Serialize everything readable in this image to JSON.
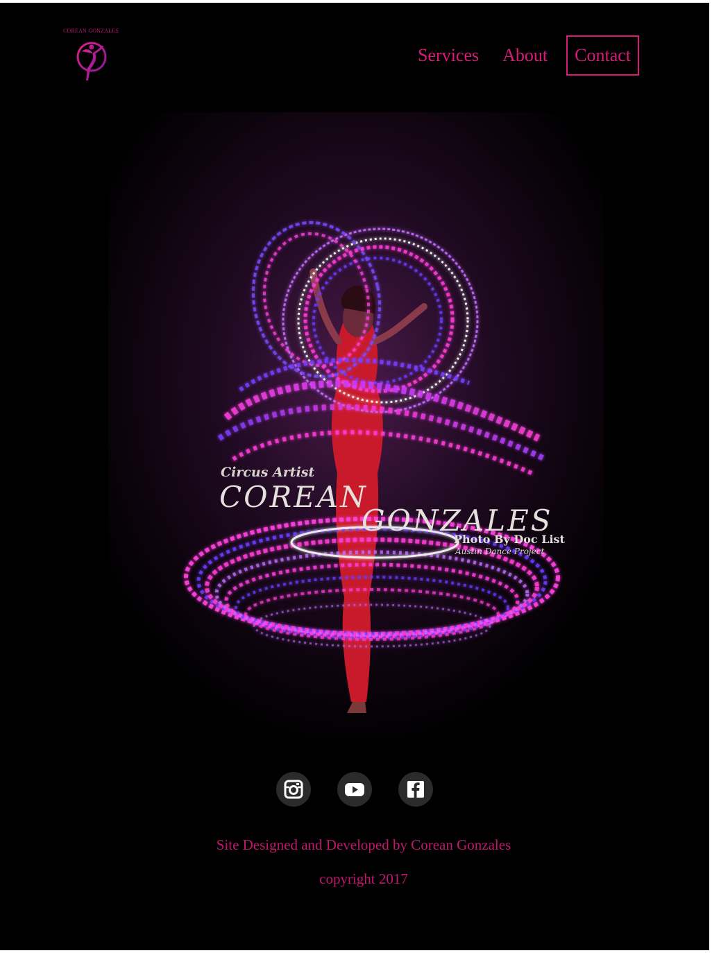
{
  "logo": {
    "text": "COREAN GONZALES",
    "icon": "aerial-hoop-dancer-icon"
  },
  "nav": {
    "items": [
      {
        "label": "Services"
      },
      {
        "label": "About"
      },
      {
        "label": "Contact"
      }
    ]
  },
  "hero": {
    "subtitle": "Circus Artist",
    "first_name": "COREAN",
    "last_name": "GONZALES",
    "photo_credit": "Photo By Doc List",
    "project": "Austin Dance Project"
  },
  "social": [
    {
      "icon": "instagram-icon"
    },
    {
      "icon": "youtube-icon"
    },
    {
      "icon": "facebook-icon"
    }
  ],
  "footer": {
    "credit": "Site Designed and Developed by Corean Gonzales",
    "copyright": "copyright 2017"
  },
  "colors": {
    "accent": "#d81b78",
    "background": "#000000",
    "light_trail_pink": "#ff2fd0",
    "light_trail_violet": "#6a3dff"
  }
}
